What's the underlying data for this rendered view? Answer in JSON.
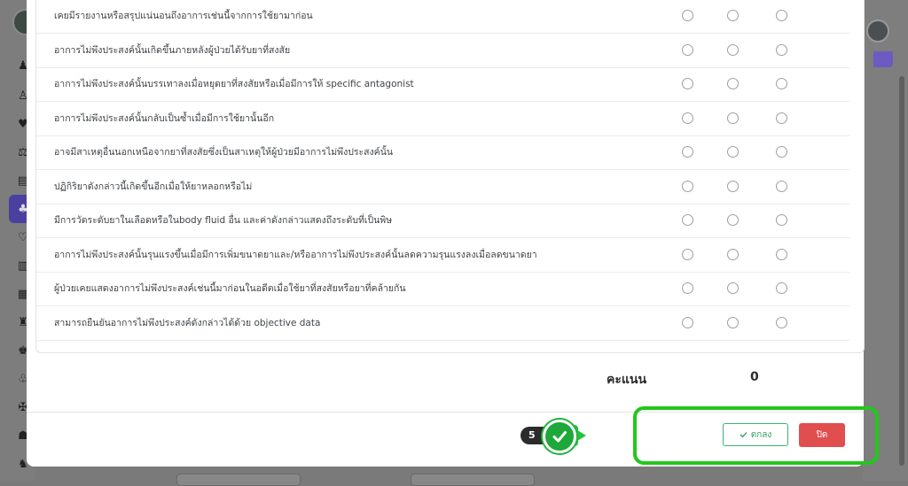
{
  "questions": [
    {
      "text": "เคยมีรายงานหรือสรุปแน่นอนถึงอาการเช่นนี้จากการใช้ยามาก่อน"
    },
    {
      "text": "อาการไม่พึงประสงค์นั้นเกิดขึ้นภายหลังผู้ป่วยได้รับยาที่สงสัย"
    },
    {
      "text": "อาการไม่พึงประสงค์นั้นบรรเทาลงเมื่อหยุดยาที่สงสัยหรือเมื่อมีการให้ specific antagonist"
    },
    {
      "text": "อาการไม่พึงประสงค์นั้นกลับเป็นซ้ำเมื่อมีการใช้ยานั้นอีก"
    },
    {
      "text": "อาจมีสาเหตุอื่นนอกเหนือจากยาที่สงสัยซึ่งเป็นสาเหตุให้ผู้ป่วยมีอาการไม่พึงประสงค์นั้น"
    },
    {
      "text": "ปฏิกิริยาดังกล่าวนี้เกิดขึ้นอีกเมื่อให้ยาหลอกหรือไม่"
    },
    {
      "text": "มีการวัดระดับยาในเลือดหรือในbody fluid อื่น และค่าดังกล่าวแสดงถึงระดับที่เป็นพิษ"
    },
    {
      "text": "อาการไม่พึงประสงค์นั้นรุนแรงขึ้นเมื่อมีการเพิ่มขนาดยาและ/หรืออาการไม่พึงประสงค์นั้นลดความรุนแรงลงเมื่อลดขนาดยา"
    },
    {
      "text": "ผู้ป่วยเคยแสดงอาการไม่พึงประสงค์เช่นนี้มาก่อนในอดีตเมื่อใช้ยาที่สงสัยหรือยาที่คล้ายกัน"
    },
    {
      "text": "สามารถยืนยันอาการไม่พึงประสงค์ดังกล่าวได้ด้วย objective data"
    }
  ],
  "score": {
    "label": "คะแนน",
    "value": "0"
  },
  "step_indicator": {
    "number": "5"
  },
  "buttons": {
    "ok_label": "ตกลง",
    "close_label": "ปิด"
  },
  "colors": {
    "ok_border": "#3cb371",
    "close_bg": "#e04e4e",
    "highlight": "#22c71b",
    "check": "#1fa83a"
  }
}
